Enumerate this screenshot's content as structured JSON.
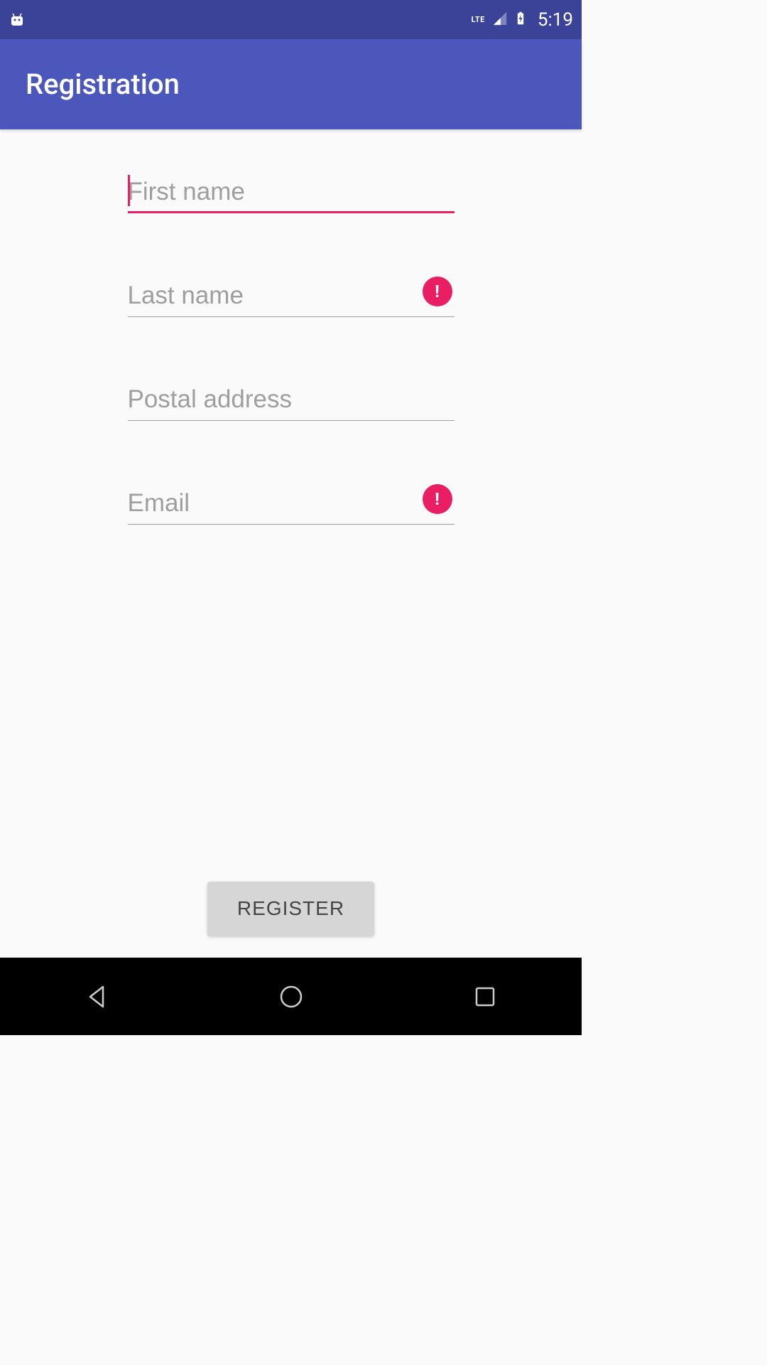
{
  "status_bar": {
    "lte_label": "LTE",
    "time": "5:19"
  },
  "app_bar": {
    "title": "Registration"
  },
  "form": {
    "first_name": {
      "placeholder": "First name",
      "value": "",
      "focused": true,
      "has_error": false
    },
    "last_name": {
      "placeholder": "Last name",
      "value": "",
      "focused": false,
      "has_error": true
    },
    "postal_address": {
      "placeholder": "Postal address",
      "value": "",
      "focused": false,
      "has_error": false
    },
    "email": {
      "placeholder": "Email",
      "value": "",
      "focused": false,
      "has_error": true
    }
  },
  "register_button": {
    "label": "REGISTER"
  }
}
